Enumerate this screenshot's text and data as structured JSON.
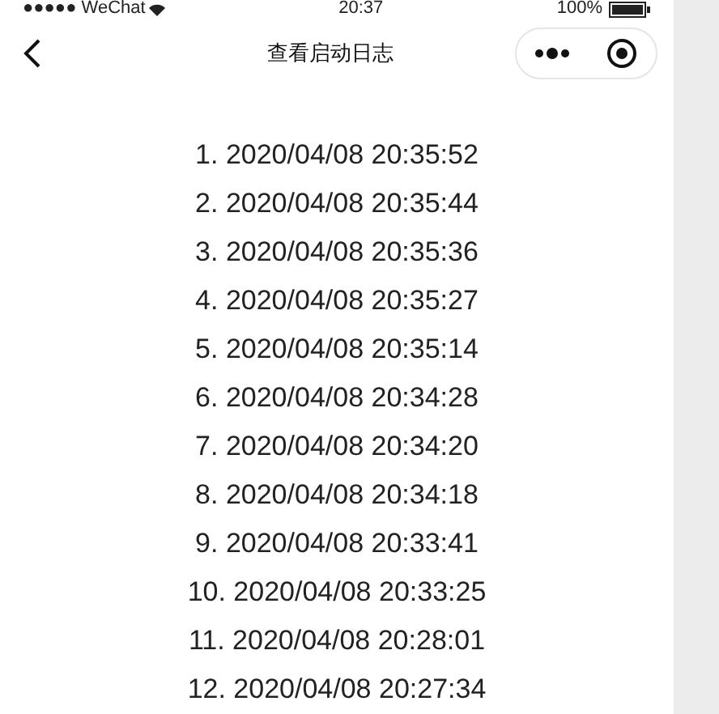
{
  "status_bar": {
    "carrier": "●●●●● WeChat",
    "time": "20:37",
    "battery": "100%"
  },
  "nav": {
    "title": "查看启动日志"
  },
  "log_entries": [
    "1. 2020/04/08 20:35:52",
    "2. 2020/04/08 20:35:44",
    "3. 2020/04/08 20:35:36",
    "4. 2020/04/08 20:35:27",
    "5. 2020/04/08 20:35:14",
    "6. 2020/04/08 20:34:28",
    "7. 2020/04/08 20:34:20",
    "8. 2020/04/08 20:34:18",
    "9. 2020/04/08 20:33:41",
    "10. 2020/04/08 20:33:25",
    "11. 2020/04/08 20:28:01",
    "12. 2020/04/08 20:27:34"
  ]
}
